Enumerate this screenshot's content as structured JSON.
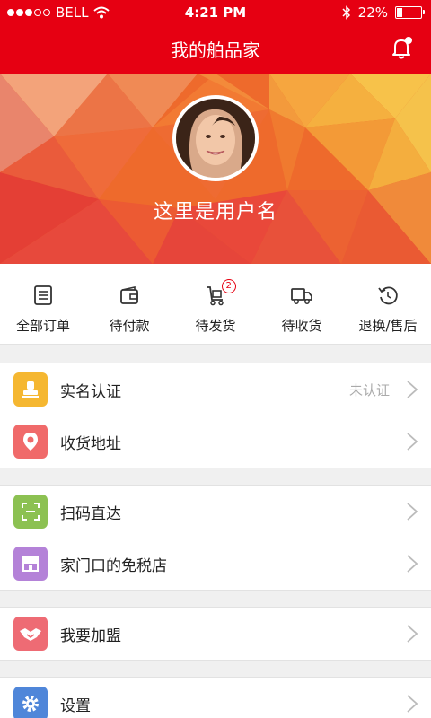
{
  "status_bar": {
    "carrier": "BELL",
    "time": "4:21 PM",
    "battery_text": "22%",
    "battery_level": 0.22,
    "signal_bars": 3
  },
  "nav": {
    "title": "我的舶品家",
    "bell_icon": "bell-icon"
  },
  "profile": {
    "username": "这里是用户名"
  },
  "orders": [
    {
      "label": "全部订单",
      "icon": "order-list-icon"
    },
    {
      "label": "待付款",
      "icon": "wallet-icon"
    },
    {
      "label": "待发货",
      "icon": "cart-ship-icon",
      "badge": "2"
    },
    {
      "label": "待收货",
      "icon": "truck-icon"
    },
    {
      "label": "退换/售后",
      "icon": "refresh-icon"
    }
  ],
  "menu": {
    "verify": {
      "label": "实名认证",
      "status": "未认证"
    },
    "address": {
      "label": "收货地址"
    },
    "scan": {
      "label": "扫码直达"
    },
    "dutyfree": {
      "label": "家门口的免税店"
    },
    "join": {
      "label": "我要加盟"
    },
    "settings": {
      "label": "设置"
    }
  },
  "colors": {
    "brand_red": "#e60012",
    "verify_icon": "#f5b731",
    "address_icon": "#f06a6a",
    "scan_icon": "#8cc152",
    "shop_icon": "#b482d8",
    "join_icon": "#ee6b74",
    "settings_icon": "#4f86d9"
  }
}
